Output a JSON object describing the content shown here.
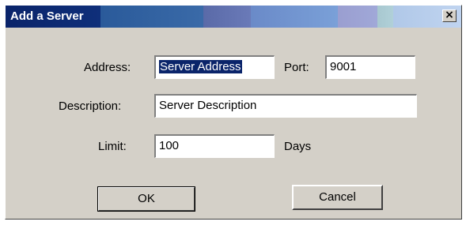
{
  "window": {
    "title": "Add a Server",
    "close_glyph": "×"
  },
  "form": {
    "address_label": "Address:",
    "address_value": "Server Address",
    "port_label": "Port:",
    "port_value": "9001",
    "description_label": "Description:",
    "description_value": "Server Description",
    "limit_label": "Limit:",
    "limit_value": "100",
    "limit_unit": "Days"
  },
  "buttons": {
    "ok": "OK",
    "cancel": "Cancel"
  }
}
